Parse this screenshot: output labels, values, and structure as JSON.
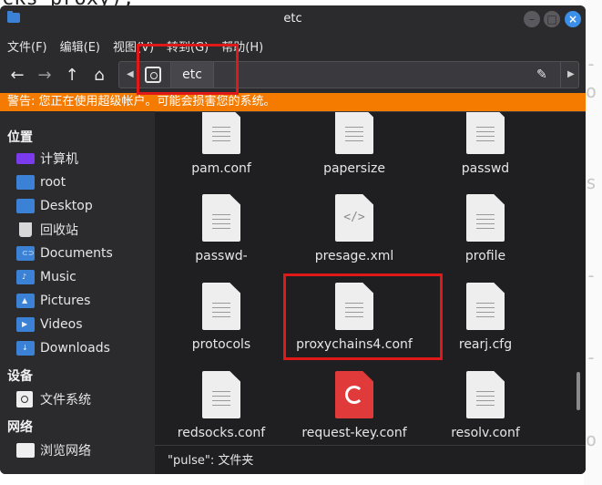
{
  "background": {
    "top_text": "cks_proxy);"
  },
  "window": {
    "title": "etc"
  },
  "menu": [
    "文件(F)",
    "编辑(E)",
    "视图(V)",
    "转到(G)",
    "帮助(H)"
  ],
  "pathbar": {
    "current": "etc"
  },
  "warning": "警告: 您正在使用超级帐户。可能会损害您的系统。",
  "sidebar": {
    "places_header": "位置",
    "places": [
      {
        "label": "计算机",
        "icon": "computer-icon"
      },
      {
        "label": "root",
        "icon": "home-icon"
      },
      {
        "label": "Desktop",
        "icon": "desktop-icon"
      },
      {
        "label": "回收站",
        "icon": "trash-icon"
      },
      {
        "label": "Documents",
        "icon": "documents-icon"
      },
      {
        "label": "Music",
        "icon": "music-icon"
      },
      {
        "label": "Pictures",
        "icon": "pictures-icon"
      },
      {
        "label": "Videos",
        "icon": "videos-icon"
      },
      {
        "label": "Downloads",
        "icon": "downloads-icon"
      }
    ],
    "devices_header": "设备",
    "devices": [
      {
        "label": "文件系统",
        "icon": "drive-icon"
      }
    ],
    "network_header": "网络",
    "network": [
      {
        "label": "浏览网络",
        "icon": "network-icon"
      }
    ]
  },
  "files": [
    {
      "name": "pam.conf",
      "type": "text"
    },
    {
      "name": "papersize",
      "type": "text"
    },
    {
      "name": "passwd",
      "type": "text"
    },
    {
      "name": "passwd-",
      "type": "text"
    },
    {
      "name": "presage.xml",
      "type": "xml"
    },
    {
      "name": "profile",
      "type": "text"
    },
    {
      "name": "protocols",
      "type": "text"
    },
    {
      "name": "proxychains4.conf",
      "type": "text"
    },
    {
      "name": "rearj.cfg",
      "type": "text"
    },
    {
      "name": "redsocks.conf",
      "type": "text"
    },
    {
      "name": "request-key.conf",
      "type": "key"
    },
    {
      "name": "resolv.conf",
      "type": "text"
    }
  ],
  "status": "\"pulse\": 文件夹",
  "colors": {
    "warning": "#f47a00",
    "accent": "#3b82d6",
    "highlight": "#e01818"
  }
}
